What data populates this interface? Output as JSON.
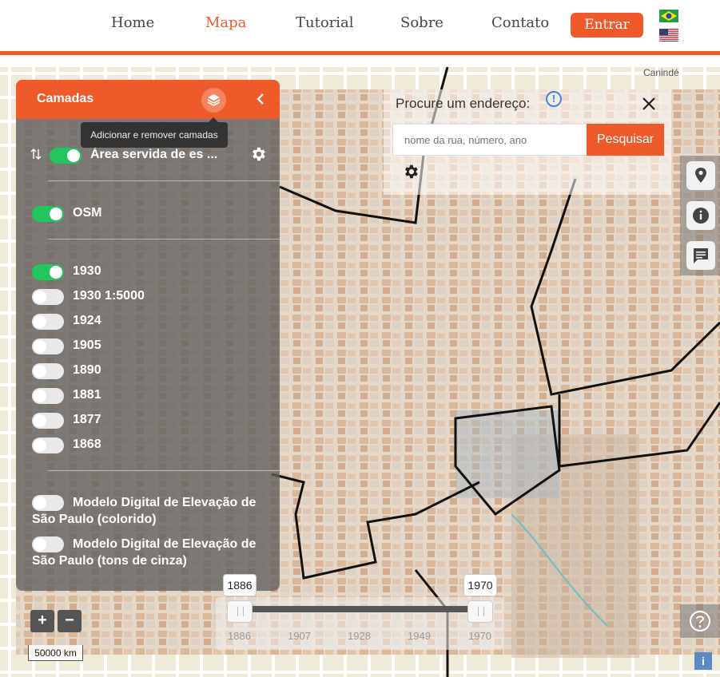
{
  "nav": {
    "home": "Home",
    "map": "Mapa",
    "tutorial": "Tutorial",
    "about": "Sobre",
    "contact": "Contato",
    "login": "Entrar",
    "flags": [
      "brazil-flag-icon",
      "us-flag-icon"
    ]
  },
  "map": {
    "place_label": "Canindé"
  },
  "layers_panel": {
    "title": "Camadas",
    "tooltip": "Adicionar e remover camadas",
    "top_layer": "Área servida de es ...",
    "osm": "OSM",
    "years": [
      {
        "label": "1930",
        "on": true
      },
      {
        "label": "1930 1:5000",
        "on": false
      },
      {
        "label": "1924",
        "on": false
      },
      {
        "label": "1905",
        "on": false
      },
      {
        "label": "1890",
        "on": false
      },
      {
        "label": "1881",
        "on": false
      },
      {
        "label": "1877",
        "on": false
      },
      {
        "label": "1868",
        "on": false
      }
    ],
    "elevation_color_line1": "Modelo Digital de Elevação de",
    "elevation_color_line2": "São Paulo (colorido)",
    "elevation_gray_line1": "Modelo Digital de Elevação de",
    "elevation_gray_line2": "São Paulo (tons de cinza)"
  },
  "search": {
    "title": "Procure um endereço:",
    "placeholder": "nome da rua, número, ano",
    "button": "Pesquisar"
  },
  "zoom": {
    "in": "+",
    "out": "−"
  },
  "scale": "50000 km",
  "time_slider": {
    "start": "1886",
    "end": "1970",
    "ticks": [
      "1886",
      "1907",
      "1928",
      "1949",
      "1970"
    ]
  },
  "colors": {
    "accent": "#ef5a2b",
    "toggle_on": "#22c55e"
  }
}
